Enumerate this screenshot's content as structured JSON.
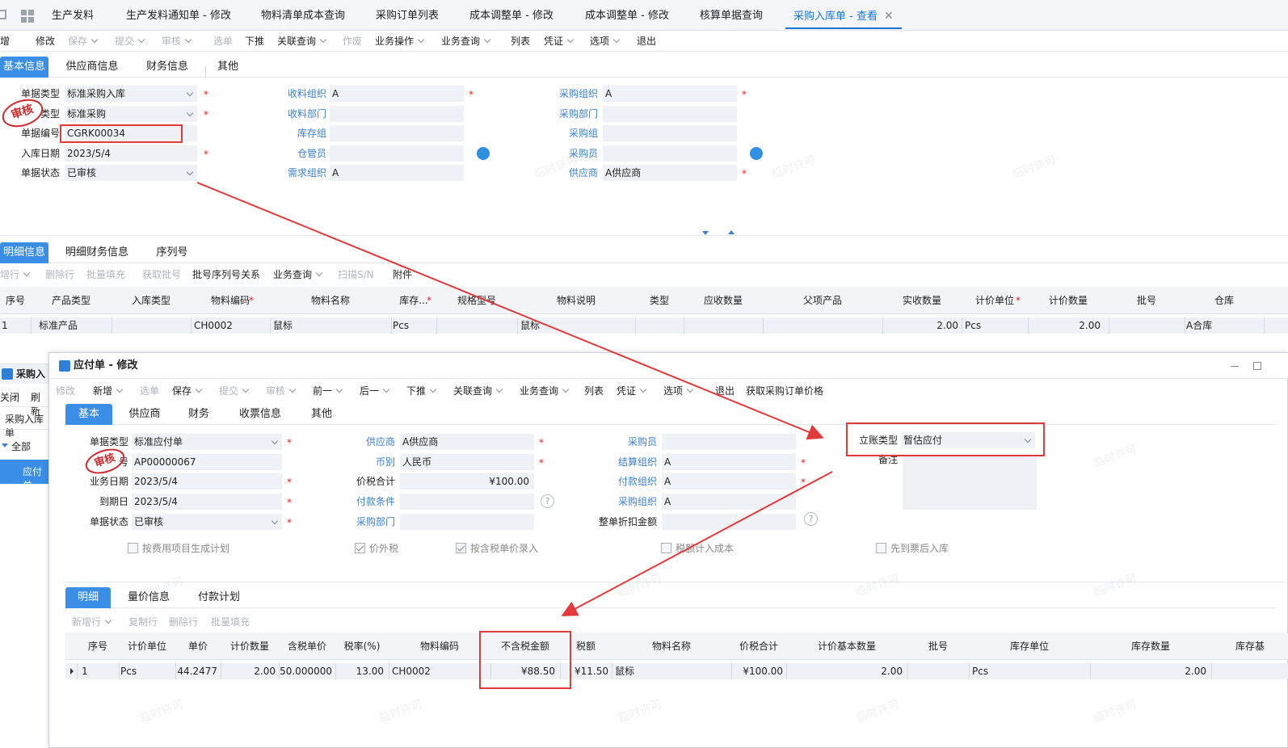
{
  "tabs": [
    "生产发料",
    "生产发料通知单 - 修改",
    "物料清单成本查询",
    "采购订单列表",
    "成本调整单 - 修改",
    "成本调整单 - 修改",
    "核算单据查询",
    "采购入库单 - 查看"
  ],
  "toolbar1": [
    "增",
    "修改",
    "保存",
    "提交",
    "审核",
    "选单",
    "下推",
    "关联查询",
    "作废",
    "业务操作",
    "业务查询",
    "列表",
    "凭证",
    "选项",
    "退出"
  ],
  "head_tabs": [
    "基本信息",
    "供应商信息",
    "财务信息",
    "其他"
  ],
  "form1": {
    "l_billtype": "单据类型",
    "v_billtype": "标准采购入库",
    "l_biztype": "类型",
    "v_biztype": "标准采购",
    "l_billno": "单据编号",
    "v_billno": "CGRK00034",
    "l_date": "入库日期",
    "v_date": "2023/5/4",
    "l_status": "单据状态",
    "v_status": "已审核",
    "l_recorg": "收料组织",
    "v_recorg": "A",
    "l_recdept": "收料部门",
    "l_stockgrp": "库存组",
    "l_keeper": "仓管员",
    "l_reqorg": "需求组织",
    "v_reqorg": "A",
    "l_purorg": "采购组织",
    "v_purorg": "A",
    "l_purdept": "采购部门",
    "l_purgrp": "采购组",
    "l_buyer": "采购员",
    "l_supplier": "供应商",
    "v_supplier": "A供应商",
    "stamp": "审核"
  },
  "detail_tabs": [
    "明细信息",
    "明细财务信息",
    "序列号"
  ],
  "toolbar2": [
    "增行",
    "删除行",
    "批量填充",
    "获取批号",
    "批号序列号关系",
    "业务查询",
    "扫描S/N",
    "附件"
  ],
  "grid1_headers": [
    "序号",
    "产品类型",
    "入库类型",
    "物料编码",
    "物料名称",
    "库存...",
    "规格型号",
    "物料说明",
    "类型",
    "应收数量",
    "父项产品",
    "实收数量",
    "计价单位",
    "计价数量",
    "批号",
    "仓库"
  ],
  "grid1_row": [
    "1",
    "标准产品",
    "",
    "CH0002",
    "鼠标",
    "Pcs",
    "",
    "鼠标",
    "",
    "",
    "",
    "2.00",
    "Pcs",
    "2.00",
    "",
    "A合库"
  ],
  "left_panel": {
    "title": "采购入",
    "btn_close": "关闭",
    "btn_refresh": "刷新",
    "item_list": "采购入库单",
    "tree_all": "全部",
    "tree_ap": "应付单"
  },
  "dialog": {
    "title": "应付单 - 修改",
    "toolbar": [
      "修改",
      "新增",
      "选单",
      "保存",
      "提交",
      "审核",
      "前一",
      "后一",
      "下推",
      "关联查询",
      "业务查询",
      "列表",
      "凭证",
      "选项",
      "退出",
      "获取采购订单价格"
    ],
    "tabs": [
      "基本",
      "供应商",
      "财务",
      "收票信息",
      "其他"
    ],
    "l_billtype": "单据类型",
    "v_billtype": "标准应付单",
    "l_billno": "号",
    "v_billno": "AP00000067",
    "l_bizdate": "业务日期",
    "v_bizdate": "2023/5/4",
    "l_due": "到期日",
    "v_due": "2023/5/4",
    "l_status": "单据状态",
    "v_status": "已审核",
    "l_supplier": "供应商",
    "v_supplier": "A供应商",
    "l_currency": "币别",
    "v_currency": "人民币",
    "l_total": "价税合计",
    "v_total": "¥100.00",
    "l_payterm": "付款条件",
    "l_purdept": "采购部门",
    "l_buyer": "采购员",
    "l_settleorg": "结算组织",
    "v_settleorg": "A",
    "l_payorg": "付款组织",
    "v_payorg": "A",
    "l_purorg": "采购组织",
    "v_purorg": "A",
    "l_discount": "整单折扣金额",
    "l_accttype": "立账类型",
    "v_accttype": "暂估应付",
    "l_remark": "备注",
    "stamp": "审核",
    "chk_fee": "按费用项目生成计划",
    "chk_extax": "价外税",
    "chk_taxprice": "按含税单价录入",
    "chk_taxcost": "税额计入成本",
    "chk_invfirst": "先到票后入库",
    "detail_tabs": [
      "明细",
      "量价信息",
      "付款计划"
    ],
    "detail_toolbar": [
      "新增行",
      "复制行",
      "删除行",
      "批量填充"
    ],
    "grid_headers": [
      "序号",
      "计价单位",
      "单价",
      "计价数量",
      "含税单价",
      "税率(%)",
      "物料编码",
      "不含税金额",
      "税额",
      "物料名称",
      "价税合计",
      "计价基本数量",
      "批号",
      "库存单位",
      "库存数量",
      "库存基"
    ],
    "grid_row": [
      "1",
      "Pcs",
      "44.2477",
      "2.00",
      "50.000000",
      "13.00",
      "CH0002",
      "¥88.50",
      "¥11.50",
      "鼠标",
      "¥100.00",
      "2.00",
      "",
      "Pcs",
      "2.00",
      ""
    ]
  },
  "watermark": "临时许可"
}
